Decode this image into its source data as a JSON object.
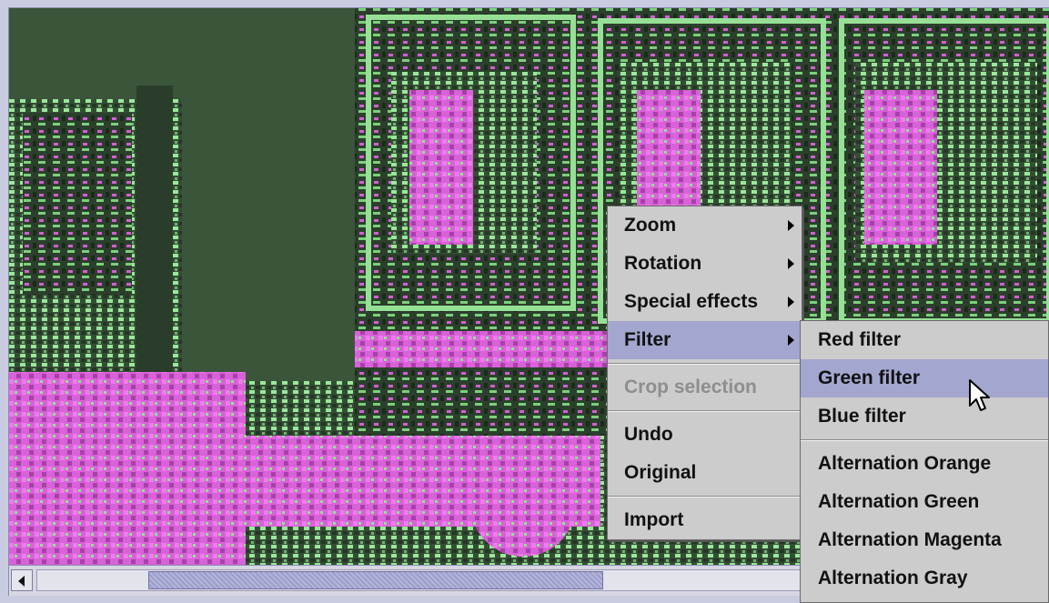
{
  "image_view": {
    "subject": "false-color filtered street scene with magenta and green overlay"
  },
  "scrollbar": {
    "position": 0.11,
    "visible_fraction": 0.45
  },
  "context_menu": {
    "items": [
      {
        "label": "Zoom",
        "submenu": true,
        "enabled": true
      },
      {
        "label": "Rotation",
        "submenu": true,
        "enabled": true
      },
      {
        "label": "Special effects",
        "submenu": true,
        "enabled": true
      },
      {
        "label": "Filter",
        "submenu": true,
        "enabled": true,
        "highlighted": true
      },
      {
        "separator": true
      },
      {
        "label": "Crop selection",
        "submenu": false,
        "enabled": false
      },
      {
        "separator": true
      },
      {
        "label": "Undo",
        "submenu": false,
        "enabled": true
      },
      {
        "label": "Original",
        "submenu": false,
        "enabled": true
      },
      {
        "separator": true
      },
      {
        "label": "Import",
        "submenu": false,
        "enabled": true
      }
    ]
  },
  "filter_submenu": {
    "items": [
      {
        "label": "Red filter"
      },
      {
        "label": "Green filter",
        "highlighted": true
      },
      {
        "label": "Blue filter"
      },
      {
        "separator": true
      },
      {
        "label": "Alternation Orange"
      },
      {
        "label": "Alternation Green"
      },
      {
        "label": "Alternation Magenta"
      },
      {
        "label": "Alternation Gray"
      }
    ]
  },
  "colors": {
    "menu_background": "#cccccc",
    "menu_highlight": "#a3a6cf",
    "disabled_text": "#8e8e8e",
    "image_base": "#3f5a3f",
    "overlay_magenta": "#e05ce0",
    "overlay_green": "#8fe68f"
  },
  "icons": {
    "scroll_left": "arrow-left-icon",
    "submenu": "chevron-right-icon",
    "pointer": "mouse-pointer-icon"
  }
}
